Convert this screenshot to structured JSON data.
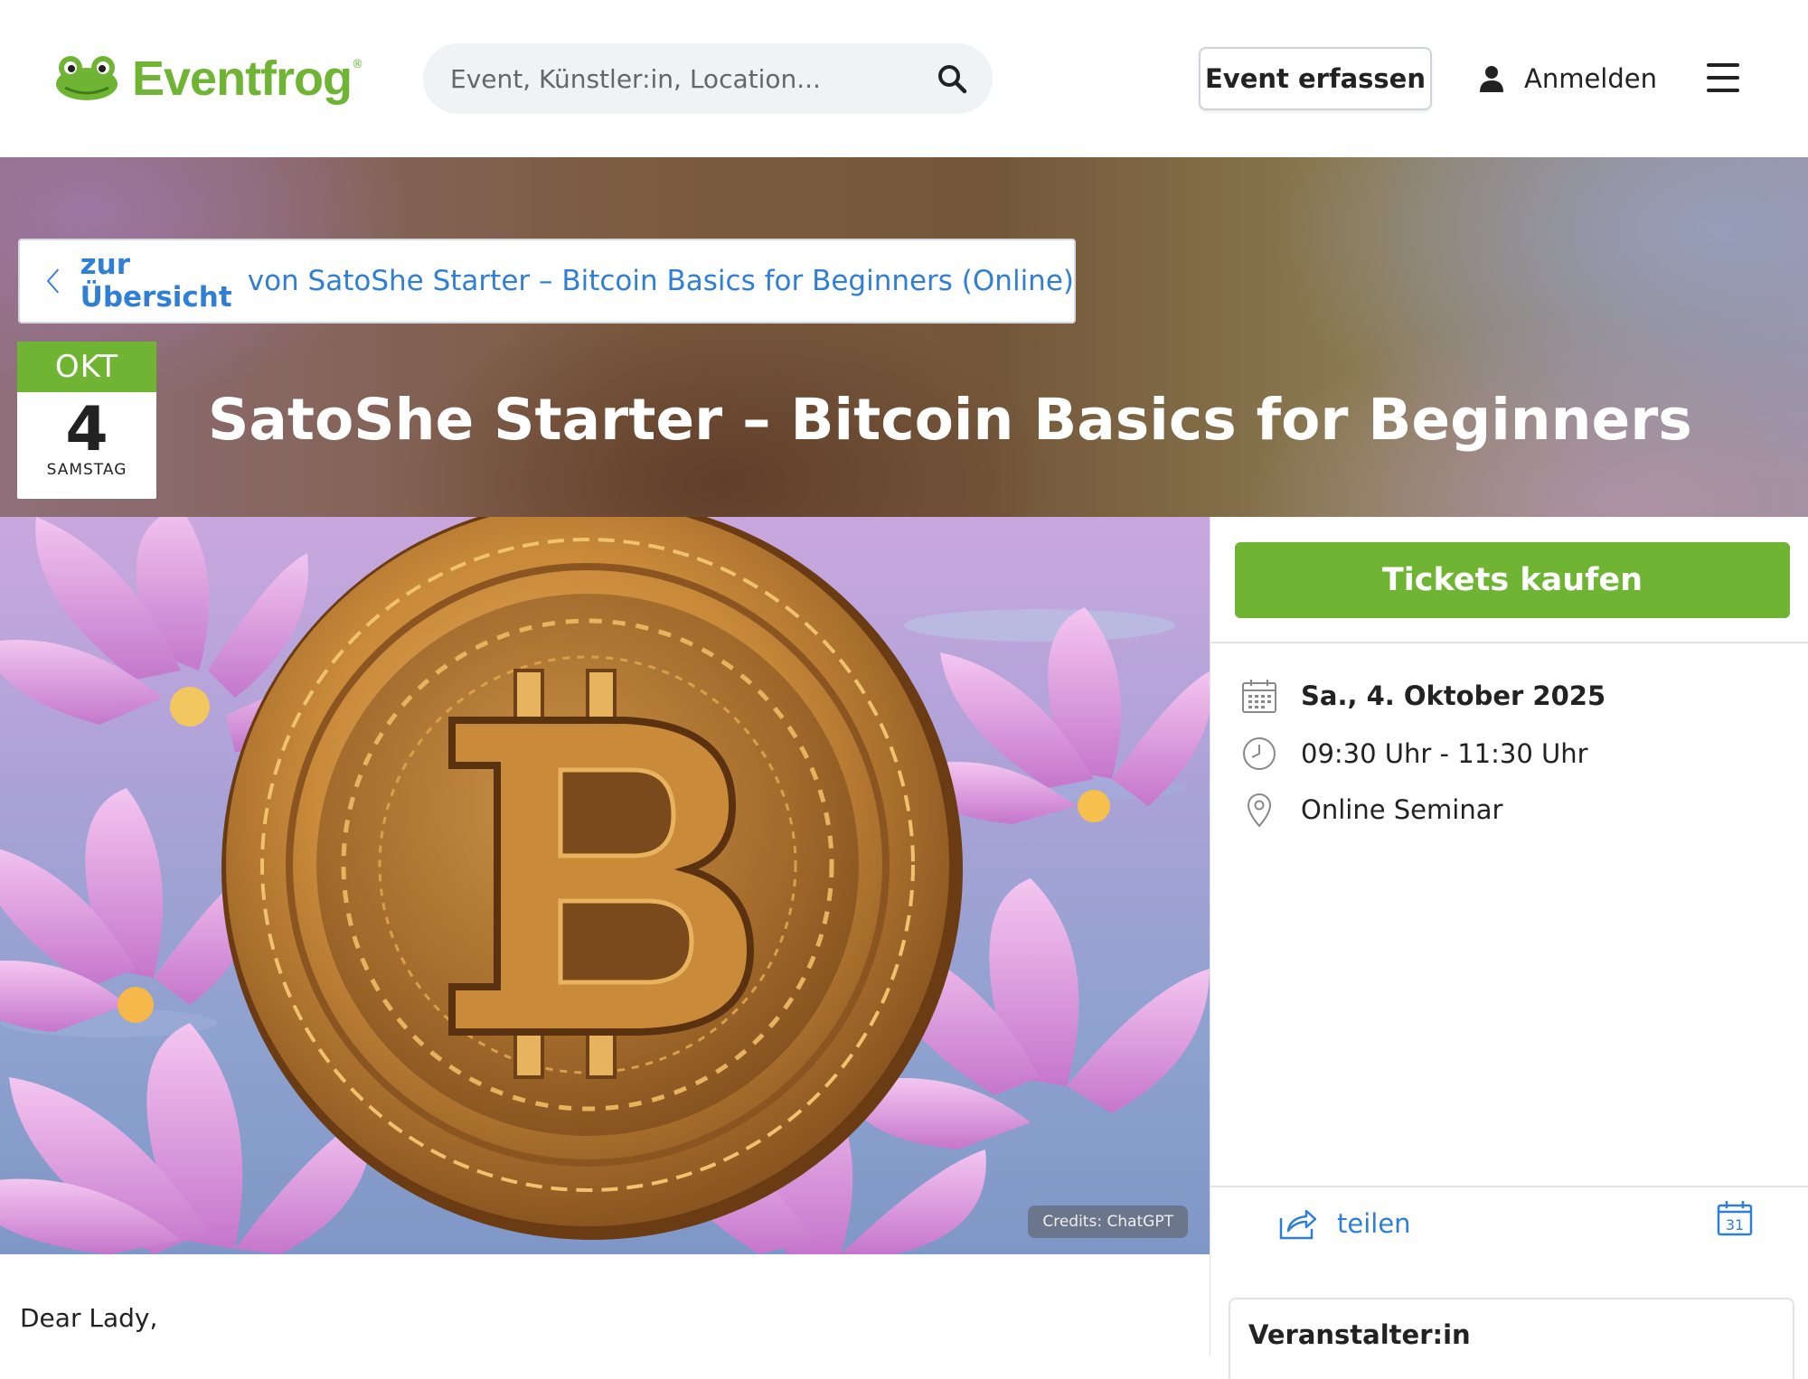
{
  "header": {
    "logo_text": "Eventfrog",
    "logo_reg": "®",
    "search_placeholder": "Event, Künstler:in, Location...",
    "create_event_label": "Event erfassen",
    "login_label": "Anmelden"
  },
  "breadcrumb": {
    "back_strong": "zur Übersicht",
    "back_rest": "von SatoShe Starter – Bitcoin Basics for Beginners (Online)"
  },
  "date_badge": {
    "month": "OKT",
    "day": "4",
    "weekday": "SAMSTAG"
  },
  "event": {
    "title": "SatoShe Starter – Bitcoin Basics for Beginners",
    "image_credits": "Credits: ChatGPT"
  },
  "sidebar": {
    "tickets_label": "Tickets kaufen",
    "date": "Sa., 4. Oktober 2025",
    "time": "09:30 Uhr - 11:30 Uhr",
    "location": "Online Seminar",
    "share_label": "teilen",
    "organizer_label": "Veranstalter:in"
  },
  "description": {
    "greeting": "Dear Lady,"
  },
  "colors": {
    "brand_green": "#6fb533",
    "link_blue": "#2f7fd6",
    "coin_gold": "#c98a3a"
  },
  "icons": [
    "frog-logo-icon",
    "search-icon",
    "user-icon",
    "menu-icon",
    "chevron-left-icon",
    "calendar-icon",
    "clock-icon",
    "location-pin-icon",
    "share-icon",
    "calendar-add-icon"
  ]
}
